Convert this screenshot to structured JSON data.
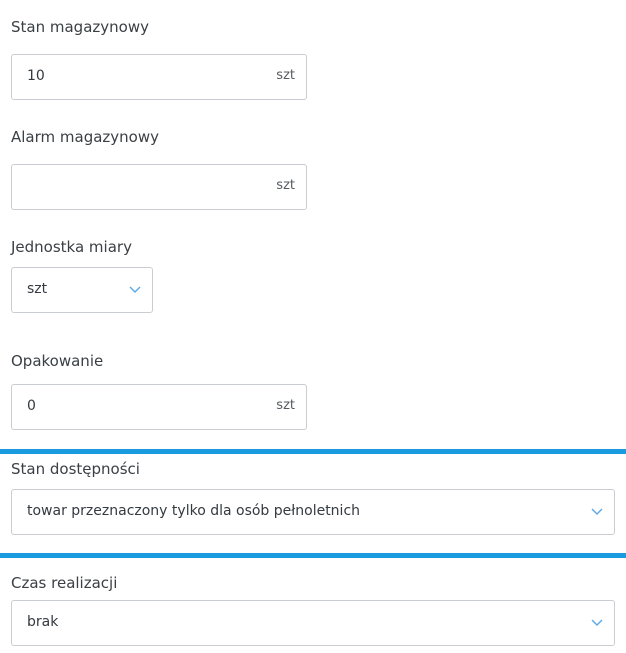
{
  "fields": {
    "stock": {
      "label": "Stan magazynowy",
      "value": "10",
      "unit": "szt"
    },
    "stock_alarm": {
      "label": "Alarm magazynowy",
      "value": "",
      "unit": "szt"
    },
    "unit_of_measure": {
      "label": "Jednostka miary",
      "selected": "szt"
    },
    "packaging": {
      "label": "Opakowanie",
      "value": "0",
      "unit": "szt"
    },
    "availability": {
      "label": "Stan dostępności",
      "selected": "towar przeznaczony tylko dla osób pełnoletnich"
    },
    "lead_time": {
      "label": "Czas realizacji",
      "selected": "brak"
    }
  },
  "colors": {
    "highlight": "#1a9be0",
    "border": "#c9cdd1",
    "chevron": "#5aa8e6"
  },
  "icons": {
    "select_arrow": "chevron-down-icon"
  }
}
